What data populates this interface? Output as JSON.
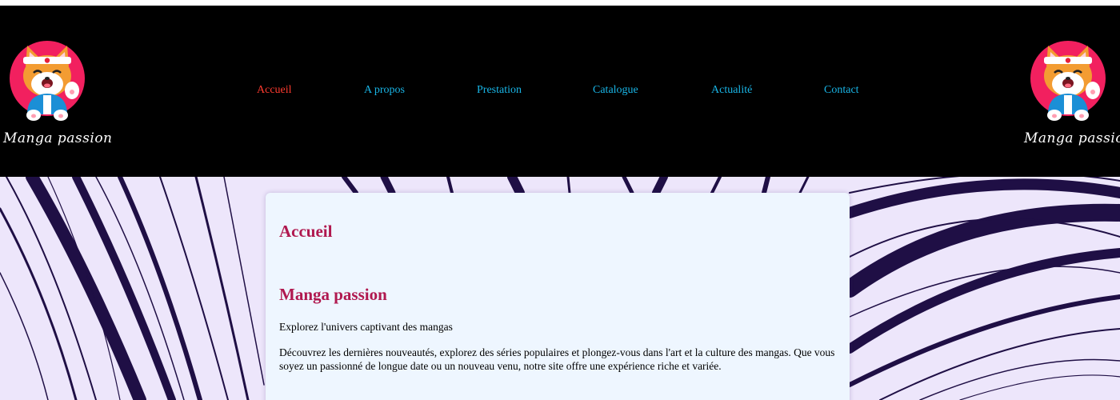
{
  "header": {
    "logo_text": "Manga passion",
    "nav": [
      {
        "label": "Accueil",
        "active": true
      },
      {
        "label": "A propos",
        "active": false
      },
      {
        "label": "Prestation",
        "active": false
      },
      {
        "label": "Catalogue",
        "active": false
      },
      {
        "label": "Actualité",
        "active": false
      },
      {
        "label": "Contact",
        "active": false
      }
    ]
  },
  "content": {
    "page_title": "Accueil",
    "heading": "Manga passion",
    "tagline": "Explorez l'univers captivant des mangas",
    "description": "Découvrez les dernières nouveautés, explorez des séries populaires et plongez-vous dans l'art et la culture des mangas. Que vous soyez un passionné de longue date ou un nouveau venu, notre site offre une expérience riche et variée."
  },
  "colors": {
    "header_bg": "#000000",
    "nav_link": "#19b5e6",
    "nav_active": "#ff3b2f",
    "heading": "#b0184f",
    "card_bg": "#eef6ff",
    "hero_bg": "#ede6fb",
    "stroke_dark": "#1f0f45"
  }
}
